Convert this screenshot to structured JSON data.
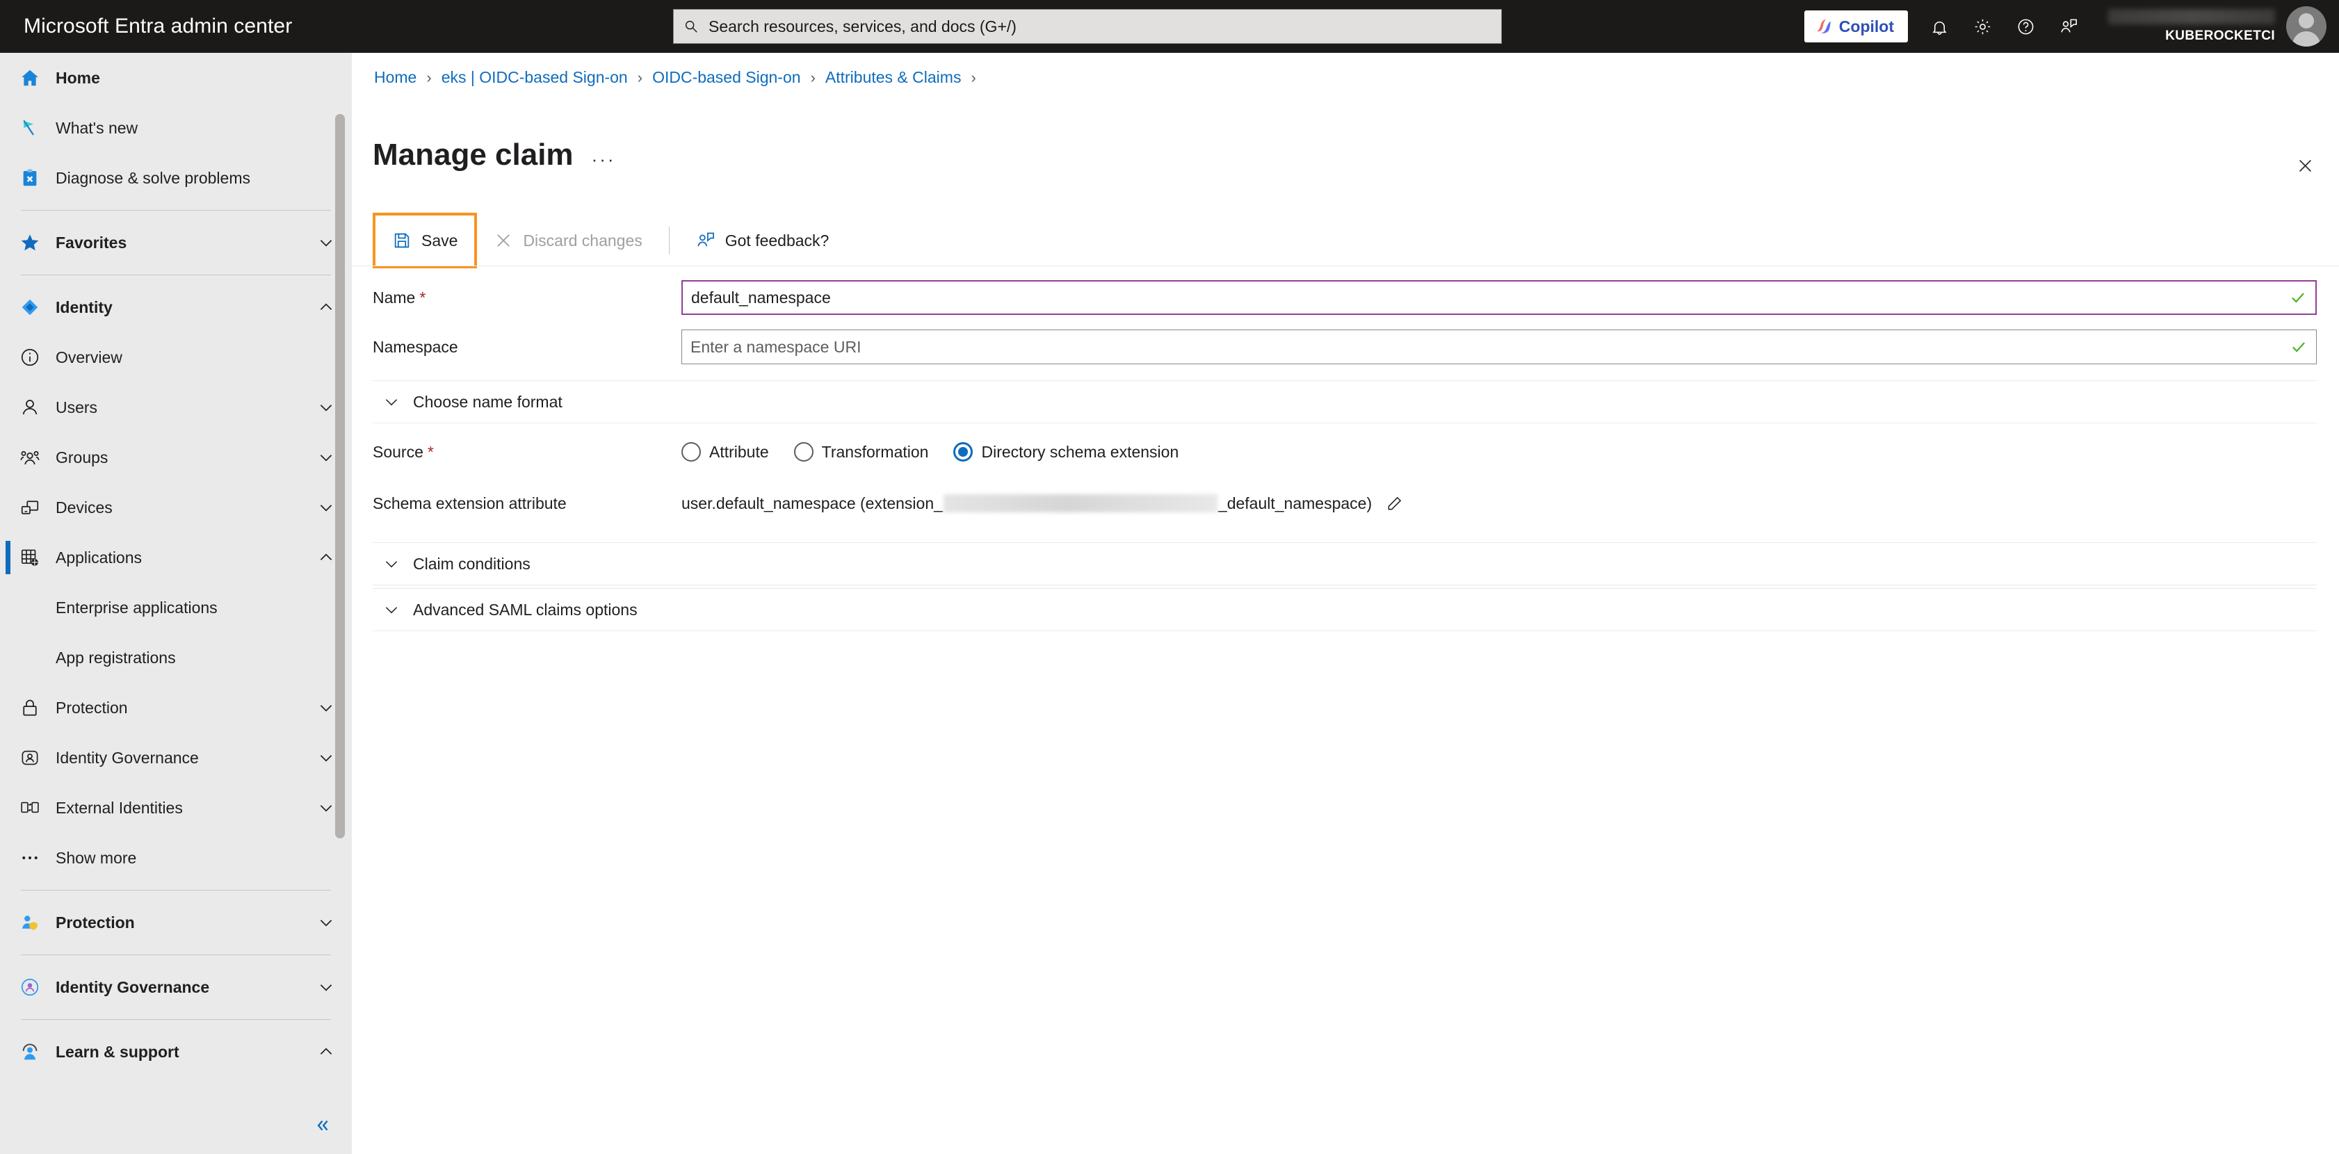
{
  "topbar": {
    "brand": "Microsoft Entra admin center",
    "search": {
      "placeholder": "Search resources, services, and docs (G+/)",
      "value": "",
      "icon": "search-icon"
    },
    "copilot_label": "Copilot",
    "icons": [
      {
        "name": "notifications-bell-icon"
      },
      {
        "name": "settings-gear-icon"
      },
      {
        "name": "help-question-icon"
      },
      {
        "name": "feedback-person-icon"
      }
    ],
    "tenant_name": "KUBEROCKETCI",
    "colors": {
      "bar_bg": "#1b1a19",
      "copilot_text": "#2f4eb8"
    }
  },
  "sidebar": {
    "groups": [
      {
        "items": [
          {
            "label": "Home",
            "icon": "home-icon",
            "bold": true,
            "chevron": "",
            "selected": false
          },
          {
            "label": "What's new",
            "icon": "flag-icon",
            "bold": false,
            "chevron": "",
            "selected": false
          },
          {
            "label": "Diagnose & solve problems",
            "icon": "clipboard-wrench-icon",
            "bold": false,
            "chevron": "",
            "selected": false
          }
        ]
      },
      {
        "items": [
          {
            "label": "Favorites",
            "icon": "star-icon",
            "bold": true,
            "chevron": "down",
            "selected": false
          }
        ]
      },
      {
        "items": [
          {
            "label": "Identity",
            "icon": "identity-diamond-icon",
            "bold": true,
            "chevron": "up",
            "selected": false
          },
          {
            "label": "Overview",
            "icon": "info-circle-icon",
            "bold": false,
            "chevron": "",
            "selected": false
          },
          {
            "label": "Users",
            "icon": "user-icon",
            "bold": false,
            "chevron": "down",
            "selected": false
          },
          {
            "label": "Groups",
            "icon": "groups-icon",
            "bold": false,
            "chevron": "down",
            "selected": false
          },
          {
            "label": "Devices",
            "icon": "devices-icon",
            "bold": false,
            "chevron": "down",
            "selected": false
          },
          {
            "label": "Applications",
            "icon": "applications-grid-icon",
            "bold": false,
            "chevron": "up",
            "selected": true
          }
        ],
        "subitems": [
          {
            "label": "Enterprise applications"
          },
          {
            "label": "App registrations"
          }
        ],
        "tail": [
          {
            "label": "Protection",
            "icon": "lock-icon",
            "bold": false,
            "chevron": "down",
            "selected": false
          },
          {
            "label": "Identity Governance",
            "icon": "governance-icon",
            "bold": false,
            "chevron": "down",
            "selected": false
          },
          {
            "label": "External Identities",
            "icon": "external-identities-icon",
            "bold": false,
            "chevron": "down",
            "selected": false
          },
          {
            "label": "Show more",
            "icon": "ellipsis-icon",
            "bold": false,
            "chevron": "",
            "selected": false
          }
        ]
      },
      {
        "items": [
          {
            "label": "Protection",
            "icon": "protection-shield-person-icon",
            "bold": true,
            "chevron": "down",
            "selected": false
          }
        ]
      },
      {
        "items": [
          {
            "label": "Identity Governance",
            "icon": "identity-governance-color-icon",
            "bold": true,
            "chevron": "down",
            "selected": false
          }
        ]
      },
      {
        "items": [
          {
            "label": "Learn & support",
            "icon": "learn-support-icon",
            "bold": true,
            "chevron": "up",
            "selected": false
          }
        ]
      }
    ],
    "collapse_icon": "chevron-double-left-icon"
  },
  "breadcrumb": [
    {
      "label": "Home"
    },
    {
      "label": "eks | OIDC-based Sign-on"
    },
    {
      "label": "OIDC-based Sign-on"
    },
    {
      "label": "Attributes & Claims"
    }
  ],
  "page": {
    "title": "Manage claim",
    "ellipsis": "···",
    "close_icon": "close-icon"
  },
  "toolbar": {
    "save_label": "Save",
    "save_icon": "save-disk-icon",
    "save_highlight_color": "#f7941e",
    "discard_label": "Discard changes",
    "discard_icon": "close-x-icon",
    "feedback_label": "Got feedback?",
    "feedback_icon": "feedback-person-icon"
  },
  "form": {
    "name": {
      "label": "Name",
      "required": true,
      "value": "default_namespace",
      "valid": true,
      "focused": true
    },
    "namespace": {
      "label": "Namespace",
      "required": false,
      "value": "",
      "placeholder": "Enter a namespace URI",
      "valid": true,
      "focused": false
    },
    "choose_name_format": {
      "label": "Choose name format",
      "expanded": false
    },
    "source": {
      "label": "Source",
      "required": true,
      "options": [
        {
          "label": "Attribute",
          "selected": false
        },
        {
          "label": "Transformation",
          "selected": false
        },
        {
          "label": "Directory schema extension",
          "selected": true
        }
      ]
    },
    "schema_extension_attribute": {
      "label": "Schema extension attribute",
      "value_prefix": "user.default_namespace (extension_",
      "value_redacted": true,
      "value_suffix": "_default_namespace)",
      "edit_icon": "pencil-edit-icon"
    },
    "claim_conditions": {
      "label": "Claim conditions",
      "expanded": false
    },
    "advanced_saml": {
      "label": "Advanced SAML claims options",
      "expanded": false
    }
  }
}
